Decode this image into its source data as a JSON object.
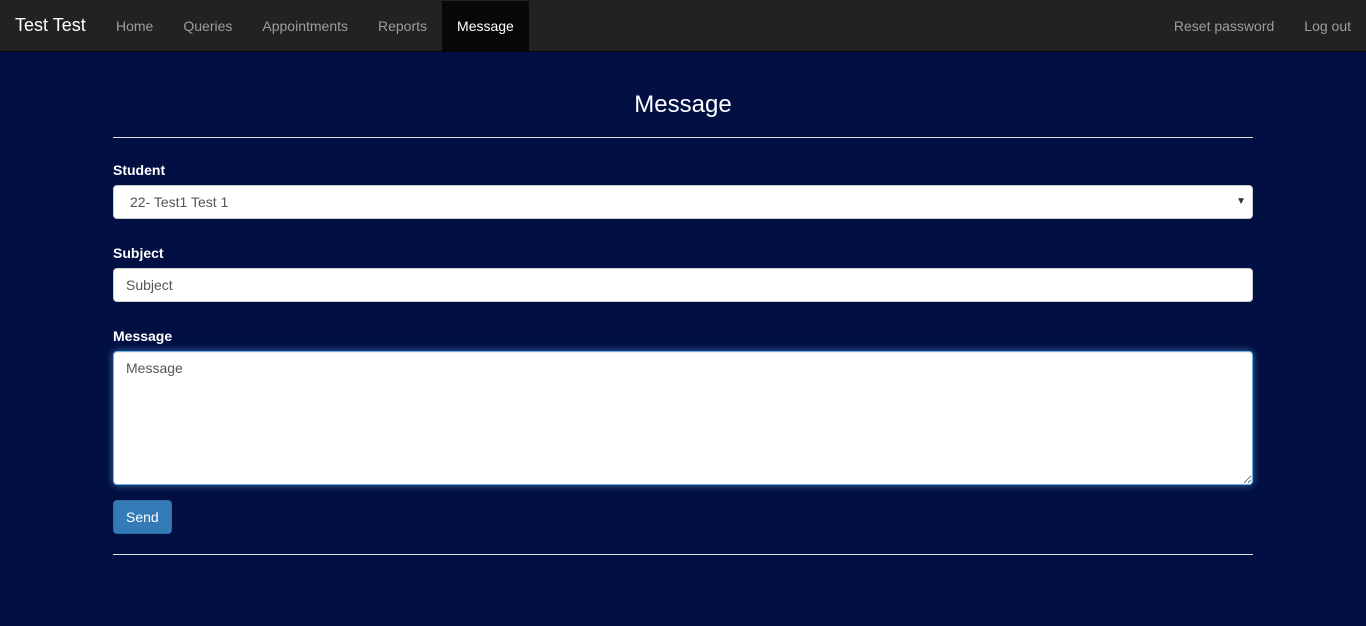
{
  "navbar": {
    "brand": "Test Test",
    "left_items": [
      {
        "label": "Home"
      },
      {
        "label": "Queries"
      },
      {
        "label": "Appointments"
      },
      {
        "label": "Reports"
      },
      {
        "label": "Message"
      }
    ],
    "active_item": "Message",
    "right_items": [
      {
        "label": "Reset password"
      },
      {
        "label": "Log out"
      }
    ]
  },
  "page": {
    "title": "Message"
  },
  "form": {
    "student_label": "Student",
    "student_selected": "22- Test1 Test 1",
    "subject_label": "Subject",
    "subject_placeholder": "Subject",
    "message_label": "Message",
    "message_value": "Message",
    "send_label": "Send"
  },
  "colors": {
    "page_background": "#010f42",
    "navbar_background": "#222222",
    "active_nav_background": "#080808",
    "primary_button": "#337ab7"
  }
}
